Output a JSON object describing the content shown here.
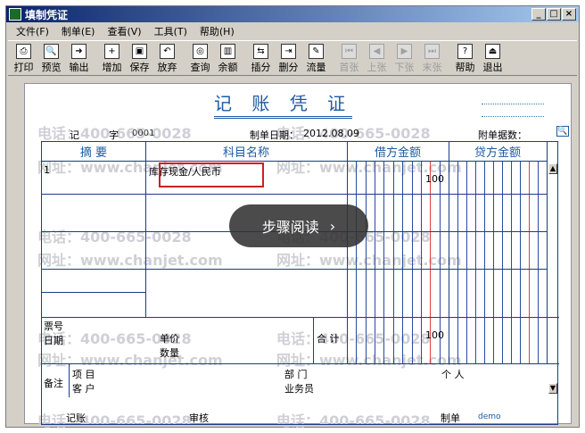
{
  "window": {
    "title": "填制凭证"
  },
  "menu": [
    "文件(F)",
    "制单(E)",
    "查看(V)",
    "工具(T)",
    "帮助(H)"
  ],
  "toolbar": [
    {
      "label": "打印",
      "icon": "print-icon",
      "glyph": "⎙",
      "disabled": false
    },
    {
      "label": "预览",
      "icon": "preview-icon",
      "glyph": "🔍",
      "disabled": false
    },
    {
      "label": "输出",
      "icon": "export-icon",
      "glyph": "➜",
      "disabled": false
    },
    {
      "label": "增加",
      "icon": "add-icon",
      "glyph": "+",
      "disabled": false
    },
    {
      "label": "保存",
      "icon": "save-icon",
      "glyph": "▣",
      "disabled": false
    },
    {
      "label": "放弃",
      "icon": "discard-icon",
      "glyph": "↶",
      "disabled": false
    },
    {
      "label": "查询",
      "icon": "query-icon",
      "glyph": "◎",
      "disabled": false
    },
    {
      "label": "余额",
      "icon": "balance-icon",
      "glyph": "▥",
      "disabled": false
    },
    {
      "label": "插分",
      "icon": "insert-split-icon",
      "glyph": "⇆",
      "disabled": false
    },
    {
      "label": "删分",
      "icon": "delete-split-icon",
      "glyph": "⇥",
      "disabled": false
    },
    {
      "label": "流量",
      "icon": "cashflow-icon",
      "glyph": "✎",
      "disabled": false
    },
    {
      "label": "首张",
      "icon": "first-icon",
      "glyph": "⏮",
      "disabled": true
    },
    {
      "label": "上张",
      "icon": "prev-icon",
      "glyph": "◀",
      "disabled": true
    },
    {
      "label": "下张",
      "icon": "next-icon",
      "glyph": "▶",
      "disabled": true
    },
    {
      "label": "末张",
      "icon": "last-icon",
      "glyph": "⏭",
      "disabled": true
    },
    {
      "label": "帮助",
      "icon": "help-icon",
      "glyph": "?",
      "disabled": false
    },
    {
      "label": "退出",
      "icon": "exit-icon",
      "glyph": "⏏",
      "disabled": false
    }
  ],
  "voucher": {
    "title": "记 账 凭 证",
    "type_label": "记",
    "number_label": "字",
    "number": "0001",
    "date_label": "制单日期：",
    "date": "2012.08.09",
    "attachments_label": "附单据数：",
    "headers": {
      "summary": "摘 要",
      "account": "科目名称",
      "debit": "借方金额",
      "credit": "贷方金额"
    },
    "rows": [
      {
        "summary": "1",
        "account": "库存现金/人民币",
        "debit": "100",
        "credit": ""
      }
    ],
    "footer": {
      "ticket_no": "票号",
      "date": "日期",
      "unit_price": "单价",
      "quantity": "数量",
      "total_label": "合 计",
      "total_debit": "100",
      "remark": "备注",
      "project": "项 目",
      "customer": "客 户",
      "department": "部 门",
      "salesperson": "业务员",
      "individual": "个 人"
    },
    "signatures": {
      "bookkeeper": "记账",
      "reviewer": "审核",
      "preparer": "制单",
      "preparer_name": "demo"
    }
  },
  "overlay": {
    "label": "步骤阅读",
    "arrow": "›"
  },
  "watermarks": {
    "phone": "电话：400-665-0028",
    "site": "网址：www.chanjet.com"
  },
  "colors": {
    "title_blue": "#1e5aa0",
    "grid_blue": "#1e3a8a",
    "highlight_red": "#cc2020",
    "amount_red": "#e04040"
  }
}
